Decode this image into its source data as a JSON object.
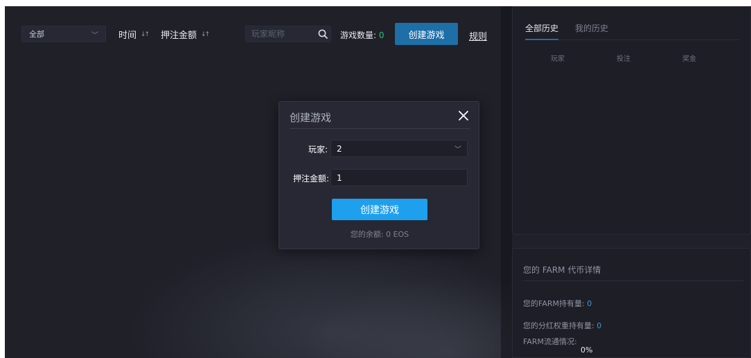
{
  "toolbar": {
    "filter": {
      "selected": "全部"
    },
    "sort_time": "时间",
    "sort_bet": "押注金额",
    "search": {
      "placeholder": "玩家昵称",
      "value": ""
    },
    "game_count_label": "游戏数量:",
    "game_count_value": "0",
    "create_label": "创建游戏",
    "rules_label": "规则"
  },
  "history": {
    "tabs": [
      {
        "label": "全部历史",
        "active": true
      },
      {
        "label": "我的历史",
        "active": false
      }
    ],
    "columns": [
      "玩家",
      "投注",
      "奖金"
    ]
  },
  "farm": {
    "title": "您的 FARM 代币详情",
    "holding_label": "您的FARM持有量:",
    "holding_value": "0",
    "weight_label": "您的分红权重持有量:",
    "weight_value": "0",
    "circulation_label": "FARM流通情况:",
    "circulation_pct": "0%"
  },
  "modal": {
    "title": "创建游戏",
    "players_label": "玩家:",
    "players_value": "2",
    "bet_label": "押注金额:",
    "bet_value": "1",
    "submit_label": "创建游戏",
    "balance_text": "您的余额: 0 EOS"
  },
  "colors": {
    "background": "#1f2028",
    "panel": "#1d1e26",
    "primary_button": "#1ea0ef",
    "top_button": "#1e6ea8",
    "count_green": "#27c07f",
    "link_blue": "#3a9bdc"
  },
  "icons": {
    "search": "search-icon",
    "close": "close-icon",
    "sort": "sort-icon",
    "chevron": "chevron-down-icon"
  }
}
